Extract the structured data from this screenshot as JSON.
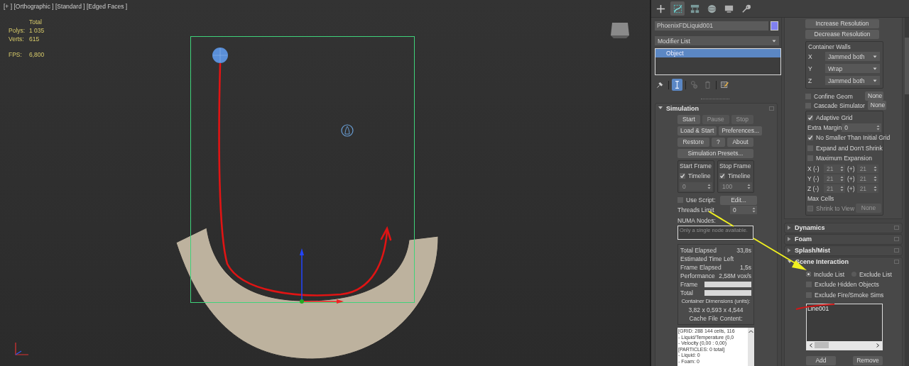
{
  "viewport": {
    "view_label": "[+ ] [Orthographic ] [Standard ] [Edged Faces ]",
    "stats_header": "Total",
    "stats": [
      {
        "label": "Polys:",
        "value": "1 035"
      },
      {
        "label": "Verts:",
        "value": "615"
      }
    ],
    "fps": {
      "label": "FPS:",
      "value": "6,800"
    }
  },
  "command_panel": {
    "tabs": [
      {
        "kind": "create",
        "selected": false
      },
      {
        "kind": "modify",
        "selected": true
      },
      {
        "kind": "hierarchy",
        "selected": false
      },
      {
        "kind": "motion",
        "selected": false
      },
      {
        "kind": "display",
        "selected": false
      },
      {
        "kind": "utilities",
        "selected": false
      }
    ],
    "object": {
      "name": "PhoenixFDLiquid001",
      "color": "#8080f0"
    },
    "modifier_list": "Modifier List",
    "stack": [
      {
        "label": "Object",
        "selected": true
      }
    ],
    "stack_tools": [
      {
        "kind": "pin",
        "on": false
      },
      {
        "kind": "show_end_result",
        "on": true
      },
      {
        "kind": "make_unique",
        "on": false
      },
      {
        "kind": "remove",
        "on": false
      },
      {
        "kind": "configure",
        "on": false
      }
    ],
    "simulation": {
      "title": "Simulation",
      "expanded": true,
      "button_rows": [
        [
          {
            "label": "Start",
            "disabled": false
          },
          {
            "label": "Pause",
            "disabled": true
          },
          {
            "label": "Stop",
            "disabled": true
          }
        ],
        [
          {
            "label": "Load & Start",
            "disabled": false
          },
          {
            "label": "Preferences...",
            "disabled": false
          }
        ],
        [
          {
            "label": "Restore",
            "disabled": false
          },
          {
            "label": "?",
            "disabled": false
          },
          {
            "label": "About",
            "disabled": false
          }
        ]
      ],
      "presets_button": "Simulation Presets...",
      "frames": [
        {
          "title": "Start Frame",
          "option": "Timeline",
          "checked": true,
          "value": "0"
        },
        {
          "title": "Stop Frame",
          "option": "Timeline",
          "checked": true,
          "value": "100"
        }
      ],
      "use_script": {
        "label": "Use Script:",
        "checked": false,
        "button": "Edit..."
      },
      "threads_limit": {
        "label": "Threads Limit",
        "value": "0"
      },
      "numa": {
        "label": "NUMA Nodes:",
        "placeholder": "Only a single node available."
      },
      "stats": [
        {
          "label": "Total Elapsed",
          "value": "33,8s"
        },
        {
          "label": "Estimated Time Left"
        },
        {
          "label": "Frame Elapsed",
          "value": "1,5s"
        },
        {
          "label": "Performance",
          "value": "2,58M vox/s"
        }
      ],
      "progress": [
        {
          "label": "Frame",
          "level": 0
        },
        {
          "label": "Total",
          "level": 0
        }
      ],
      "container_dimensions_label": "Container Dimensions (units):",
      "container_dimensions": "3,82 x 0,593 x 4,544",
      "cache_label": "Cache File Content:",
      "cache_lines": [
        "[GRID: 288 144 cells, 116",
        "- Liquid/Temperature (0,0",
        "- Velocity (0,00 : 0,00)",
        "[PARTICLES: 0 total]",
        "- Liquid: 0",
        "- Foam: 0"
      ]
    }
  },
  "grid": {
    "buttons": [
      "Increase Resolution",
      "Decrease Resolution"
    ],
    "container_walls": {
      "title": "Container Walls",
      "axes": [
        {
          "axis": "X",
          "value": "Jammed both"
        },
        {
          "axis": "Y",
          "value": "Wrap"
        },
        {
          "axis": "Z",
          "value": "Jammed both"
        }
      ]
    },
    "confine": [
      {
        "label": "Confine Geom",
        "checked": false,
        "button": "None"
      },
      {
        "label": "Cascade Simulator",
        "checked": false,
        "button": "None"
      }
    ],
    "adaptive_grid": {
      "label": "Adaptive Grid",
      "checked": true,
      "extra_margin": {
        "label": "Extra Margin",
        "value": "0"
      },
      "options": [
        {
          "label": "No Smaller Than Initial Grid",
          "checked": true
        },
        {
          "label": "Expand and Don't Shrink",
          "checked": false
        },
        {
          "label": "Maximum Expansion",
          "checked": false
        }
      ],
      "expansion": [
        {
          "minus": "X (-)",
          "minus_value": "21",
          "plus": "(+)",
          "plus_value": "21",
          "disabled": true
        },
        {
          "minus": "Y (-)",
          "minus_value": "21",
          "plus": "(+)",
          "plus_value": "21",
          "disabled": true
        },
        {
          "minus": "Z (-)",
          "minus_value": "21",
          "plus": "(+)",
          "plus_value": "21",
          "disabled": true
        }
      ],
      "max_cells": "Max Cells",
      "shrink": {
        "label": "Shrink to View",
        "checked": false,
        "button": "None",
        "disabled": true
      }
    }
  },
  "rollouts": [
    {
      "title": "Dynamics",
      "expanded": false
    },
    {
      "title": "Foam",
      "expanded": false
    },
    {
      "title": "Splash/Mist",
      "expanded": false
    },
    {
      "title": "Scene Interaction",
      "expanded": true,
      "content": {
        "modes": [
          {
            "label": "Include List",
            "selected": true
          },
          {
            "label": "Exclude List",
            "selected": false
          }
        ],
        "options": [
          {
            "label": "Exclude Hidden Objects",
            "checked": false
          },
          {
            "label": "Exclude Fire/Smoke Sims",
            "checked": false
          }
        ],
        "list": [
          {
            "label": "Line001"
          }
        ],
        "buttons": [
          "Add",
          "Remove"
        ]
      }
    }
  ]
}
